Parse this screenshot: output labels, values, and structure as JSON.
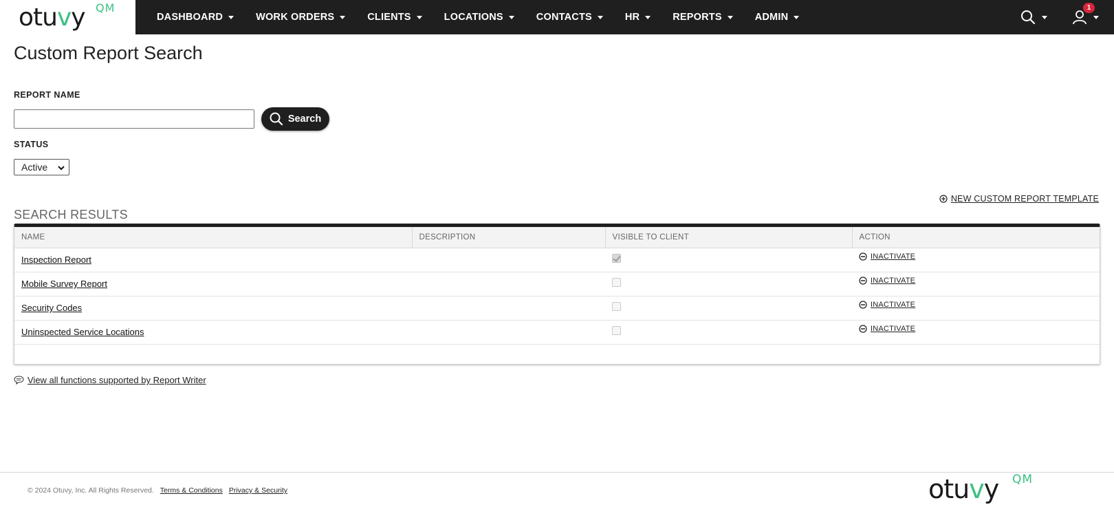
{
  "brand": {
    "logo_word_a": "otu",
    "logo_word_v": "v",
    "logo_word_b": "y",
    "logo_suffix": "QM",
    "accent_color": "#3cc081"
  },
  "nav": {
    "items": [
      {
        "label": "DASHBOARD"
      },
      {
        "label": "WORK ORDERS"
      },
      {
        "label": "CLIENTS"
      },
      {
        "label": "LOCATIONS"
      },
      {
        "label": "CONTACTS"
      },
      {
        "label": "HR"
      },
      {
        "label": "REPORTS"
      },
      {
        "label": "ADMIN"
      }
    ],
    "search_icon": "search-icon",
    "user_icon": "user-icon",
    "notification_count": "1"
  },
  "page": {
    "title": "Custom Report Search"
  },
  "filters": {
    "report_name_label": "REPORT NAME",
    "report_name_value": "",
    "search_button": "Search",
    "status_label": "STATUS",
    "status_value": "Active"
  },
  "results": {
    "new_template_link": "NEW CUSTOM REPORT TEMPLATE",
    "title": "SEARCH RESULTS",
    "columns": [
      "NAME",
      "DESCRIPTION",
      "VISIBLE TO CLIENT",
      "ACTION"
    ],
    "rows": [
      {
        "name": "Inspection Report",
        "description": "",
        "visible": true,
        "action": "INACTIVATE"
      },
      {
        "name": "Mobile Survey Report",
        "description": "",
        "visible": false,
        "action": "INACTIVATE"
      },
      {
        "name": "Security Codes",
        "description": "",
        "visible": false,
        "action": "INACTIVATE"
      },
      {
        "name": "Uninspected Service Locations",
        "description": "",
        "visible": false,
        "action": "INACTIVATE"
      }
    ]
  },
  "help": {
    "link": "View all functions supported by Report Writer"
  },
  "footer": {
    "copyright": "© 2024 Otuvy, Inc. All Rights Reserved.",
    "terms": "Terms & Conditions",
    "privacy": "Privacy & Security"
  }
}
